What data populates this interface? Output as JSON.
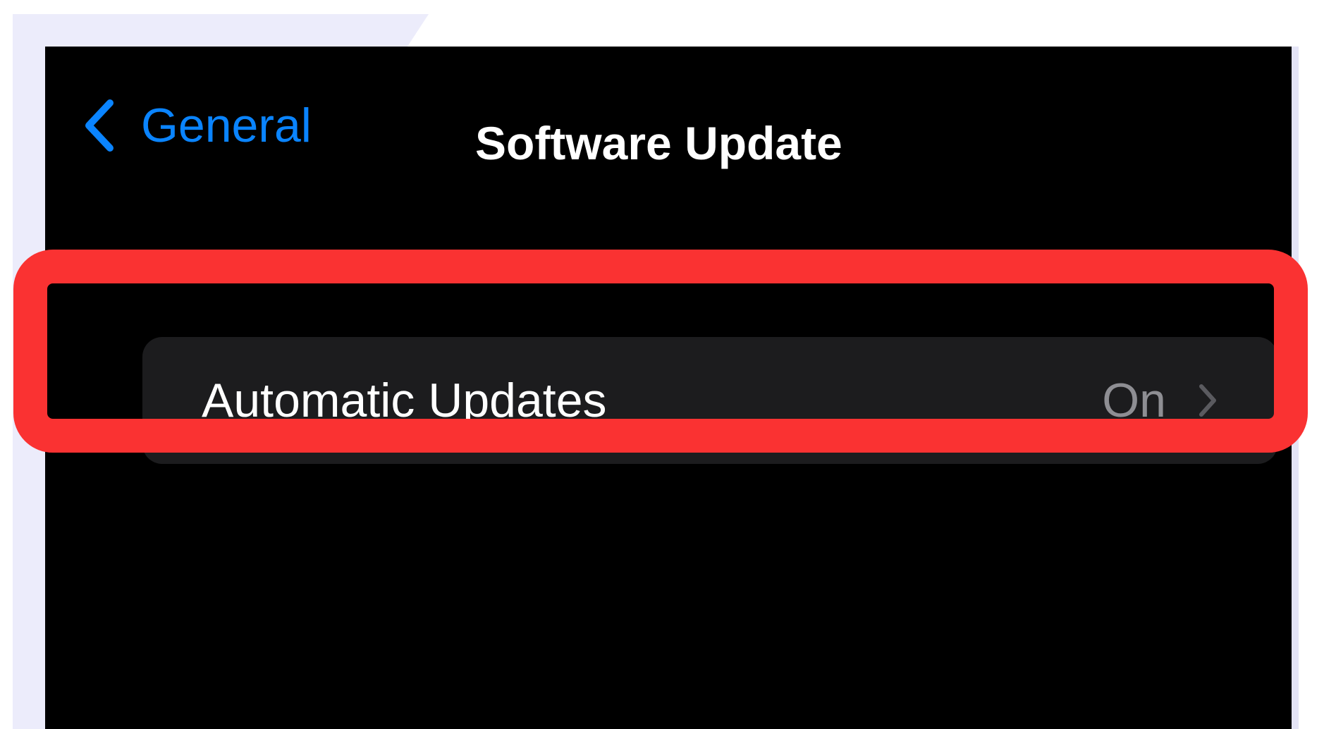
{
  "colors": {
    "accent": "#0a84ff",
    "background": "#000000",
    "row_background": "#1c1c1e",
    "secondary_text": "#8e8e93",
    "highlight": "#fa3232"
  },
  "nav": {
    "back_icon": "chevron-left-icon",
    "back_label": "General",
    "title": "Software Update"
  },
  "settings": {
    "items": [
      {
        "label": "Automatic Updates",
        "value": "On",
        "icon": "chevron-right-icon"
      }
    ]
  }
}
